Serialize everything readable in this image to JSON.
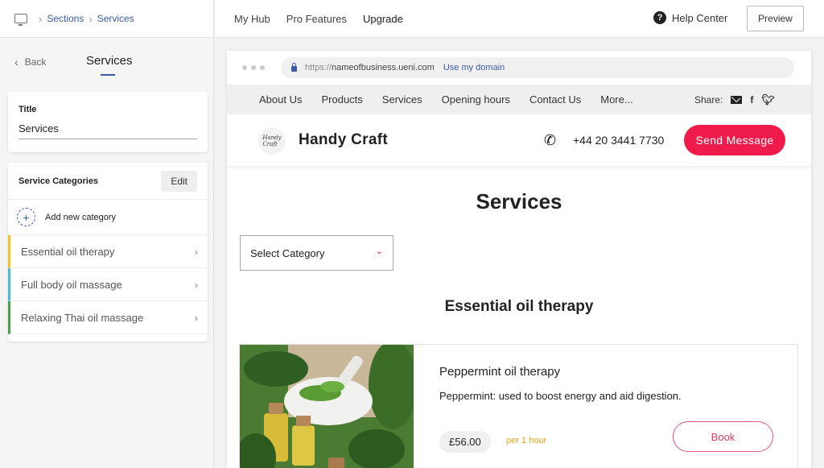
{
  "breadcrumb": {
    "section": "Sections",
    "current": "Services"
  },
  "panel": {
    "back_label": "Back",
    "title": "Services",
    "title_field": {
      "label": "Title",
      "value": "Services"
    },
    "categories": {
      "label": "Service Categories",
      "edit_label": "Edit",
      "add_label": "Add new category",
      "items": [
        {
          "label": "Essential oil therapy",
          "color": "#f4c01e"
        },
        {
          "label": "Full body oil massage",
          "color": "#4fb7d8"
        },
        {
          "label": "Relaxing Thai oil massage",
          "color": "#45a34a"
        }
      ]
    }
  },
  "topnav": {
    "items": [
      "My Hub",
      "Pro Features",
      "Upgrade"
    ],
    "help_label": "Help Center",
    "preview_label": "Preview"
  },
  "browser": {
    "url_proto": "https://",
    "url_host": "nameofbusiness.ueni.com",
    "use_domain": "Use my domain"
  },
  "site": {
    "nav": [
      "About Us",
      "Products",
      "Services",
      "Opening hours",
      "Contact Us",
      "More..."
    ],
    "share_label": "Share:",
    "logo_text": "Handy Craft",
    "brand": "Handy Craft",
    "phone": "+44 20 3441 7730",
    "send_label": "Send Message",
    "heading": "Services",
    "select_label": "Select Category",
    "category_heading": "Essential oil therapy",
    "service": {
      "name": "Peppermint oil therapy",
      "description": "Peppermint: used to boost energy and aid digestion.",
      "price": "£56.00",
      "per": "per 1 hour",
      "book_label": "Book"
    }
  },
  "colors": {
    "accent": "#ee1b4b",
    "link": "#3b5ba9",
    "per_hour": "#e0a21b"
  }
}
